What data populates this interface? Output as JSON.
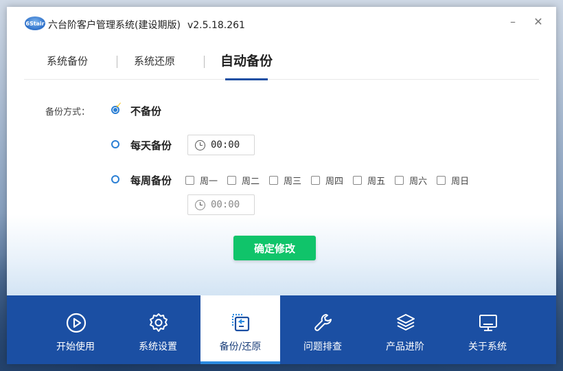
{
  "window": {
    "logo_text": "6Stair",
    "title": "六台阶客户管理系统(建设期版)",
    "version": "v2.5.18.261",
    "minimize": "–",
    "close": "✕"
  },
  "tabs": [
    {
      "label": "系统备份",
      "active": false
    },
    {
      "label": "系统还原",
      "active": false
    },
    {
      "label": "自动备份",
      "active": true
    }
  ],
  "form": {
    "label": "备份方式：",
    "options": {
      "none": {
        "label": "不备份",
        "checked": true
      },
      "daily": {
        "label": "每天备份",
        "checked": false,
        "time": "00:00"
      },
      "weekly": {
        "label": "每周备份",
        "checked": false,
        "time": "00:00"
      }
    },
    "days": [
      "周一",
      "周二",
      "周三",
      "周四",
      "周五",
      "周六",
      "周日"
    ],
    "confirm_label": "确定修改"
  },
  "colors": {
    "accent": "#1b4fa3",
    "confirm": "#10c46a",
    "radio": "#2b7fd4"
  },
  "nav": [
    {
      "label": "开始使用",
      "icon": "play-icon",
      "active": false
    },
    {
      "label": "系统设置",
      "icon": "gear-icon",
      "active": false
    },
    {
      "label": "备份/还原",
      "icon": "backup-restore-icon",
      "active": true
    },
    {
      "label": "问题排查",
      "icon": "wrench-icon",
      "active": false
    },
    {
      "label": "产品进阶",
      "icon": "layers-icon",
      "active": false
    },
    {
      "label": "关于系统",
      "icon": "monitor-icon",
      "active": false
    }
  ]
}
